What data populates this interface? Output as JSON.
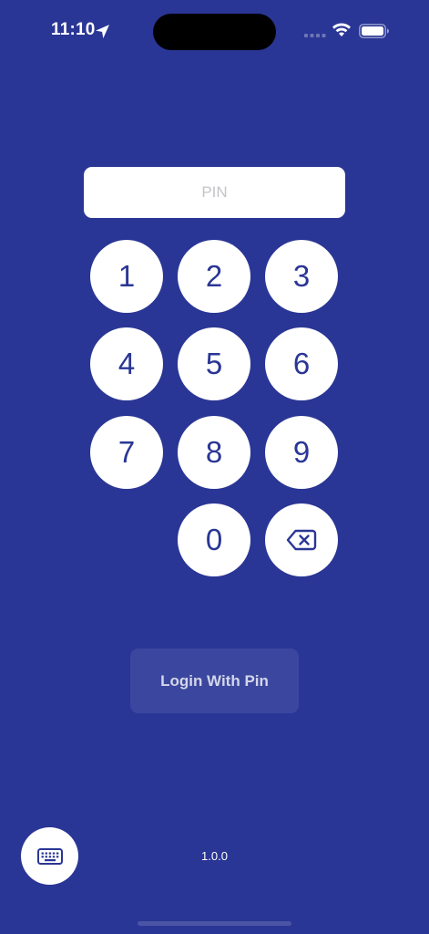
{
  "status_bar": {
    "time": "11:10",
    "icons": [
      "location-arrow-icon",
      "cellular-signal-icon",
      "wifi-icon",
      "battery-icon"
    ]
  },
  "pin_input": {
    "placeholder": "PIN",
    "value": ""
  },
  "keypad": {
    "keys": [
      "1",
      "2",
      "3",
      "4",
      "5",
      "6",
      "7",
      "8",
      "9",
      "0"
    ],
    "delete_icon": "backspace-icon"
  },
  "login_button": {
    "label": "Login With Pin"
  },
  "keyboard_toggle": {
    "icon": "keyboard-icon"
  },
  "footer": {
    "version": "1.0.0"
  },
  "colors": {
    "background": "#2a3695",
    "key_background": "#ffffff",
    "key_text": "#2a3695",
    "button_disabled_bg": "#3b479e",
    "button_disabled_text": "#d3d6ea"
  }
}
